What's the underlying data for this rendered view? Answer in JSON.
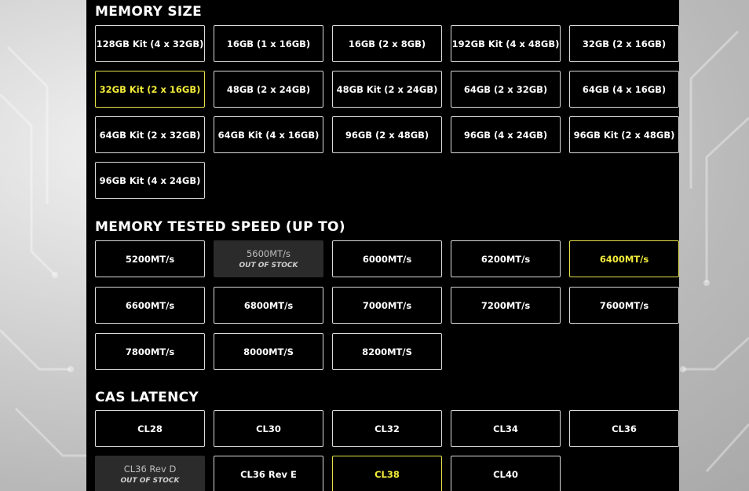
{
  "sections": {
    "memory_size": {
      "title": "MEMORY SIZE",
      "options": [
        {
          "label": "128GB Kit (4 x 32GB)"
        },
        {
          "label": "16GB (1 x 16GB)"
        },
        {
          "label": "16GB (2 x 8GB)"
        },
        {
          "label": "192GB Kit (4 x 48GB)"
        },
        {
          "label": "32GB (2 x 16GB)"
        },
        {
          "label": "32GB Kit (2 x 16GB)",
          "state": "selected"
        },
        {
          "label": "48GB (2 x 24GB)"
        },
        {
          "label": "48GB Kit (2 x 24GB)"
        },
        {
          "label": "64GB (2 x 32GB)"
        },
        {
          "label": "64GB (4 x 16GB)"
        },
        {
          "label": "64GB Kit (2 x 32GB)"
        },
        {
          "label": "64GB Kit (4 x 16GB)"
        },
        {
          "label": "96GB (2 x 48GB)"
        },
        {
          "label": "96GB (4 x 24GB)"
        },
        {
          "label": "96GB Kit (2 x 48GB)"
        },
        {
          "label": "96GB Kit (4 x 24GB)"
        }
      ]
    },
    "speed": {
      "title": "MEMORY TESTED SPEED (UP TO)",
      "options": [
        {
          "label": "5200MT/s"
        },
        {
          "label": "5600MT/s",
          "state": "out_of_stock",
          "note": "OUT OF STOCK"
        },
        {
          "label": "6000MT/s"
        },
        {
          "label": "6200MT/s"
        },
        {
          "label": "6400MT/s",
          "state": "selected"
        },
        {
          "label": "6600MT/s"
        },
        {
          "label": "6800MT/s"
        },
        {
          "label": "7000MT/s"
        },
        {
          "label": "7200MT/s"
        },
        {
          "label": "7600MT/s"
        },
        {
          "label": "7800MT/s"
        },
        {
          "label": "8000MT/S"
        },
        {
          "label": "8200MT/S"
        }
      ]
    },
    "cas": {
      "title": "CAS LATENCY",
      "options": [
        {
          "label": "CL28"
        },
        {
          "label": "CL30"
        },
        {
          "label": "CL32"
        },
        {
          "label": "CL34"
        },
        {
          "label": "CL36"
        },
        {
          "label": "CL36 Rev D",
          "state": "out_of_stock",
          "note": "OUT OF STOCK"
        },
        {
          "label": "CL36 Rev E"
        },
        {
          "label": "CL38",
          "state": "selected"
        },
        {
          "label": "CL40"
        }
      ]
    }
  },
  "colors": {
    "panel_bg": "#000000",
    "selected_accent": "#f3ec3a",
    "out_of_stock_bg": "#2b2b2b"
  }
}
